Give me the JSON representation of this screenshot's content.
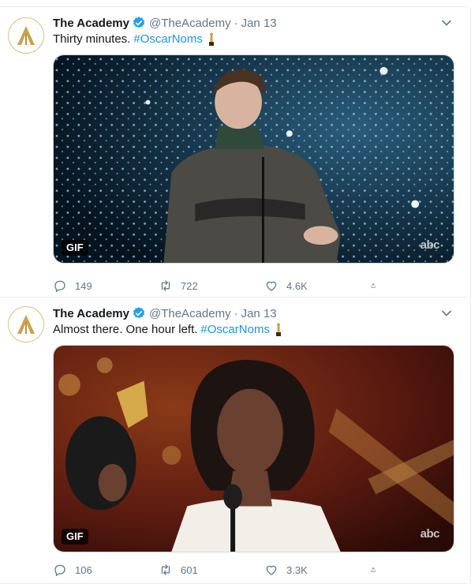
{
  "colors": {
    "link": "#1b95e0",
    "secondary_text": "#657786",
    "verified": "#1da1f2",
    "gold": "#c9a34a"
  },
  "tweets": [
    {
      "author_name": "The Academy",
      "handle": "@TheAcademy",
      "separator": "·",
      "date": "Jan 13",
      "text": "Thirty minutes.",
      "hashtag": "#OscarNoms",
      "media_badge": "GIF",
      "watermark": "abc",
      "replies": "149",
      "retweets": "722",
      "likes": "4.6K"
    },
    {
      "author_name": "The Academy",
      "handle": "@TheAcademy",
      "separator": "·",
      "date": "Jan 13",
      "text": "Almost there. One hour left.",
      "hashtag": "#OscarNoms",
      "media_badge": "GIF",
      "watermark": "abc",
      "replies": "106",
      "retweets": "601",
      "likes": "3.3K"
    }
  ]
}
